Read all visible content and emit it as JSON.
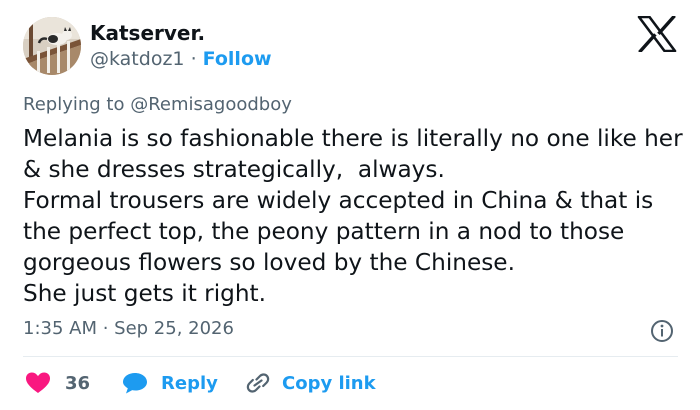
{
  "author": {
    "name": "Katserver.",
    "handle": "@katdoz1",
    "separator": "·",
    "follow_label": "Follow",
    "avatar": "cat-on-railing-photo"
  },
  "brand": {
    "logo": "x-logo-icon",
    "color": "#0f1419"
  },
  "replying": {
    "prefix": "Replying to",
    "mention": "@Remisagoodboy"
  },
  "tweet": {
    "text": "Melania is so fashionable there is literally no one like her & she dresses strategically,  always.\nFormal trousers are widely accepted in China & that is the perfect top, the peony pattern in a nod to those gorgeous flowers so loved by the Chinese.\nShe just gets it right.",
    "timestamp": "1:35 AM · Sep 25, 2026"
  },
  "actions": {
    "like_count": "36",
    "reply_label": "Reply",
    "copy_label": "Copy link"
  },
  "colors": {
    "text": "#0f1419",
    "secondary": "#536471",
    "accent": "#1d9bf0",
    "like": "#f91880",
    "divider": "#e6ecf0"
  }
}
